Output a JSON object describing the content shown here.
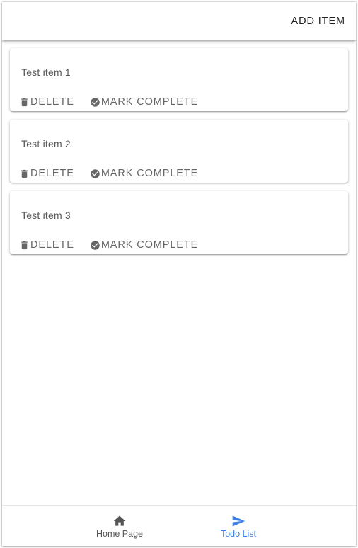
{
  "app_bar": {
    "add_item_label": "ADD ITEM"
  },
  "todos": [
    {
      "text": "Test item 1",
      "delete_label": "DELETE",
      "complete_label": "MARK COMPLETE"
    },
    {
      "text": "Test item 2",
      "delete_label": "DELETE",
      "complete_label": "MARK COMPLETE"
    },
    {
      "text": "Test item 3",
      "delete_label": "DELETE",
      "complete_label": "MARK COMPLETE"
    }
  ],
  "icons": {
    "delete": "trash-icon",
    "complete": "check-circle-icon",
    "home": "home-icon",
    "todo": "send-icon"
  },
  "bottom_nav": {
    "items": [
      {
        "label": "Home Page",
        "icon": "home-icon",
        "active": false
      },
      {
        "label": "Todo List",
        "icon": "send-icon",
        "active": true
      }
    ]
  },
  "colors": {
    "active": "#3f7fe0",
    "inactive": "#555555",
    "action_text": "#666666"
  }
}
